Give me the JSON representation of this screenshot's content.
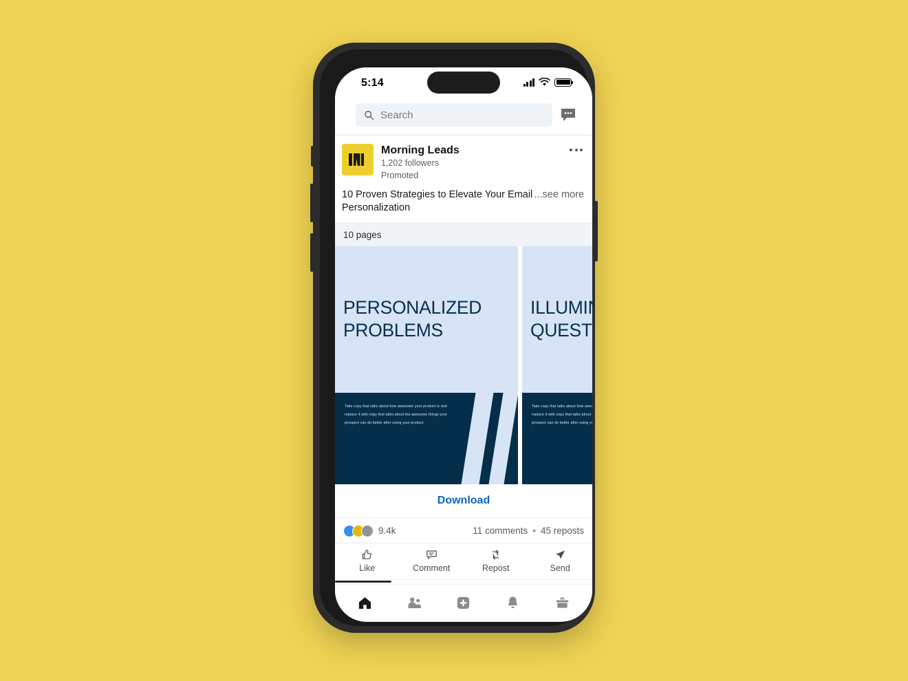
{
  "theme": {
    "page_background": "#eed253",
    "accent_link": "#0a66c2",
    "slide_light": "#d6e4f6",
    "slide_dark": "#052e4a",
    "brand_yellow": "#edd02f"
  },
  "status_bar": {
    "time": "5:14",
    "signal_icon": "cellular-bars-icon",
    "wifi_icon": "wifi-icon",
    "battery_icon": "battery-full-icon"
  },
  "search": {
    "placeholder": "Search",
    "search_icon": "search-icon",
    "messaging_icon": "messaging-bubble-icon"
  },
  "post": {
    "author": "Morning Leads",
    "followers": "1,202 followers",
    "promoted_label": "Promoted",
    "avatar_icon": "morning-leads-logo",
    "overflow_icon": "more-options-icon",
    "text": "10 Proven Strategies to Elevate Your Email Personalization",
    "see_more": "...see more",
    "pages_label": "10 pages",
    "download_label": "Download"
  },
  "carousel": {
    "slides": [
      {
        "title": "PERSONALIZED\nPROBLEMS",
        "body": "Take copy that talks about how awesome your product is and replace it with copy that talks about the awesome things your prospect can do better after using your product."
      },
      {
        "title": "ILLUMINATING\nQUESTIONS",
        "body": "Take copy that talks about how awesome your product is and replace it with copy that talks about the awesome things your prospect can do better after using your product."
      }
    ]
  },
  "engagement": {
    "reaction_count": "9.4k",
    "comments": "11 comments",
    "separator": "•",
    "reposts": "45 reposts",
    "reactions": [
      "like-reaction-icon",
      "celebrate-reaction-icon",
      "clap-reaction-icon"
    ]
  },
  "actions": [
    {
      "label": "Like",
      "icon": "thumbs-up-icon"
    },
    {
      "label": "Comment",
      "icon": "comment-bubble-icon"
    },
    {
      "label": "Repost",
      "icon": "repost-arrows-icon"
    },
    {
      "label": "Send",
      "icon": "send-paper-plane-icon"
    }
  ],
  "bottom_nav": [
    {
      "name": "home",
      "icon": "home-icon",
      "active": true
    },
    {
      "name": "network",
      "icon": "my-network-icon",
      "active": false
    },
    {
      "name": "post",
      "icon": "add-post-icon",
      "active": false
    },
    {
      "name": "notifications",
      "icon": "bell-icon",
      "active": false
    },
    {
      "name": "jobs",
      "icon": "briefcase-icon",
      "active": false
    }
  ]
}
